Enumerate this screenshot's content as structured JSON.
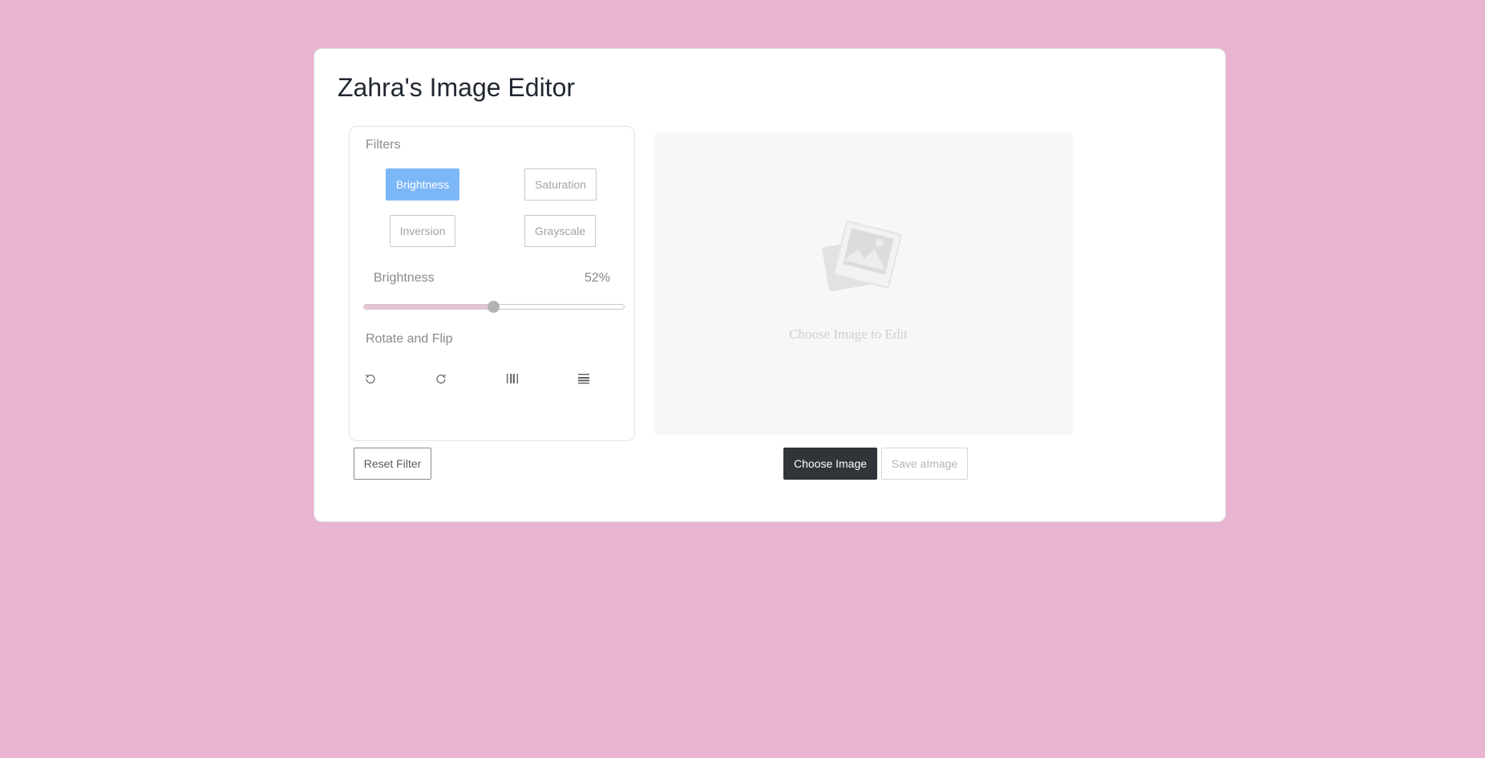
{
  "app": {
    "title": "Zahra's Image Editor"
  },
  "filters": {
    "label": "Filters",
    "buttons": [
      {
        "label": "Brightness",
        "active": true
      },
      {
        "label": "Saturation",
        "active": false
      },
      {
        "label": "Inversion",
        "active": false
      },
      {
        "label": "Grayscale",
        "active": false
      }
    ]
  },
  "slider": {
    "name": "Brightness",
    "value_text": "52%",
    "value": 0.5
  },
  "rotate": {
    "label": "Rotate and Flip",
    "icons": [
      "rotate-left-icon",
      "rotate-right-icon",
      "flip-horizontal-icon",
      "flip-vertical-icon"
    ]
  },
  "preview": {
    "placeholder_text": "Choose Image to Edit",
    "icon": "image-placeholder-icon"
  },
  "actions": {
    "reset_label": "Reset Filter",
    "choose_label": "Choose Image",
    "save_label": "Save aImage"
  },
  "colors": {
    "page_background": "#e9b4d0",
    "active_filter": "#7cb7f7",
    "choose_button": "#30353a",
    "slider_fill": "#e7c3d7"
  }
}
